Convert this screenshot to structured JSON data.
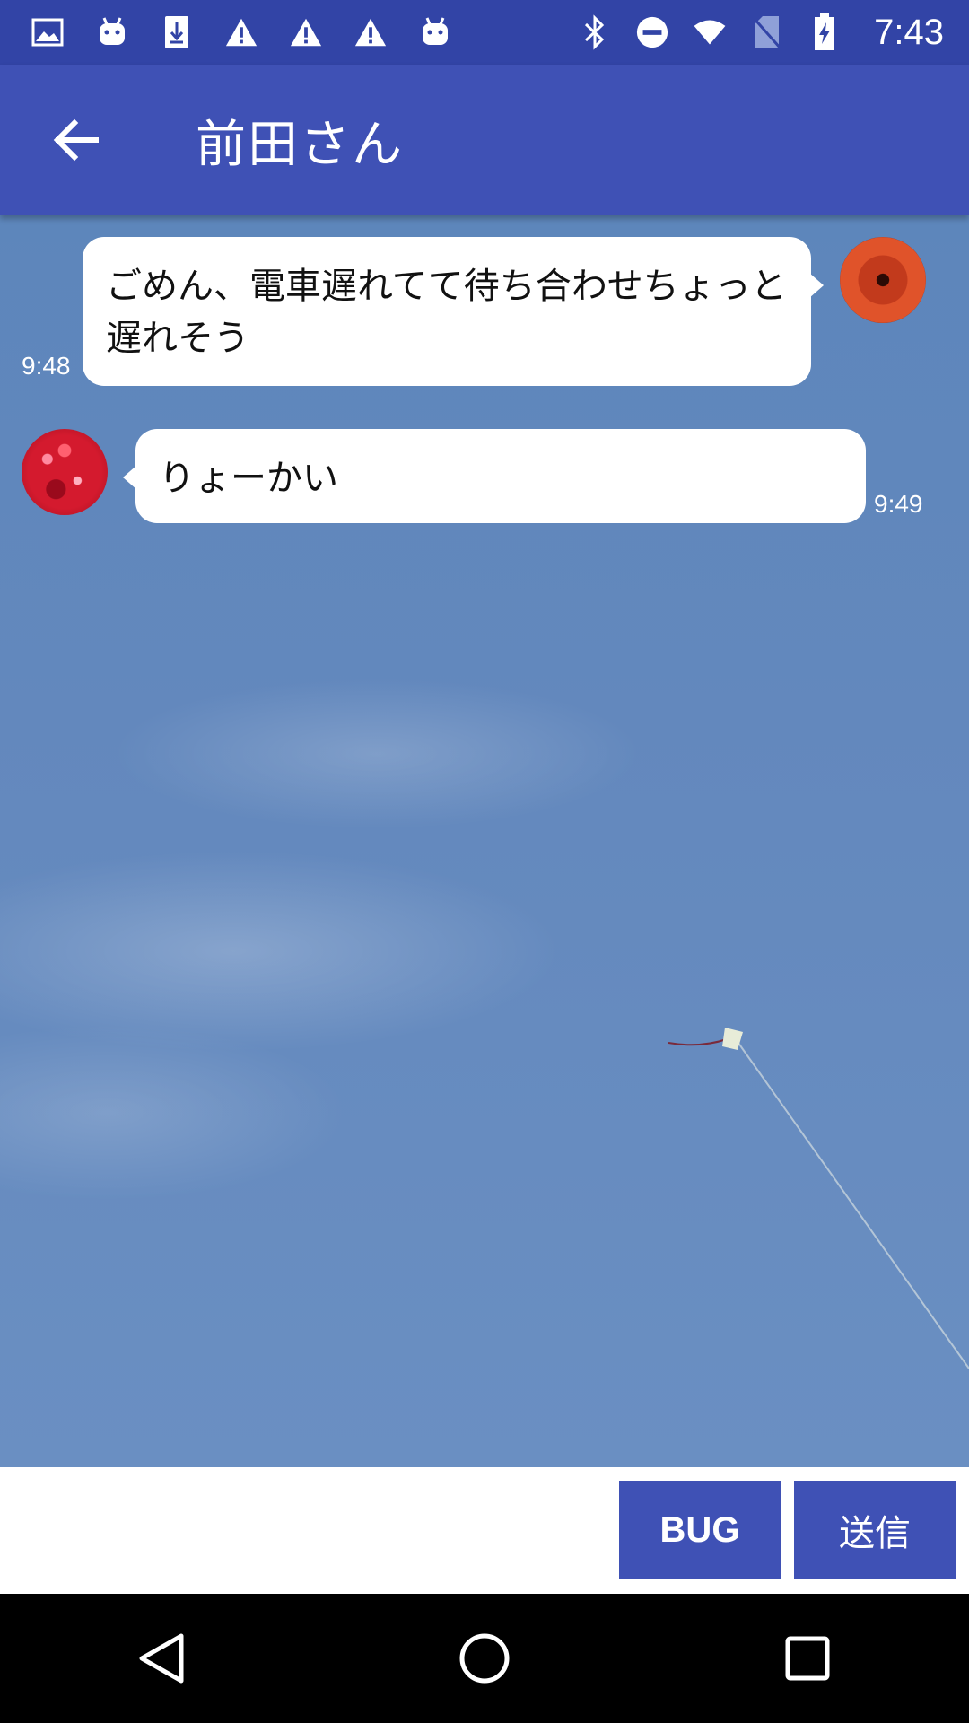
{
  "status_bar": {
    "time": "7:43",
    "left_icons": [
      "image-icon",
      "android-icon",
      "download-icon",
      "warning-icon",
      "warning-icon",
      "warning-icon",
      "android-icon"
    ],
    "right_icons": [
      "bluetooth-icon",
      "do-not-disturb-icon",
      "wifi-icon",
      "no-sim-icon",
      "battery-charging-icon"
    ]
  },
  "app_bar": {
    "title": "前田さん",
    "back_icon": "arrow-back-icon"
  },
  "messages": [
    {
      "direction": "outgoing",
      "text": "ごめん、電車遅れてて待ち合わせちょっと遅れそう",
      "time": "9:48",
      "avatar": "red-umbrella"
    },
    {
      "direction": "incoming",
      "text": "りょーかい",
      "time": "9:49",
      "avatar": "red-maple"
    }
  ],
  "input_bar": {
    "placeholder": "",
    "value": "",
    "bug_label": "BUG",
    "send_label": "送信"
  },
  "nav_bar": {
    "back_icon": "nav-back-icon",
    "home_icon": "nav-home-icon",
    "recents_icon": "nav-recents-icon"
  },
  "colors": {
    "status_bar": "#3244a6",
    "primary": "#3f51b5",
    "chat_background": "#6388bd"
  }
}
